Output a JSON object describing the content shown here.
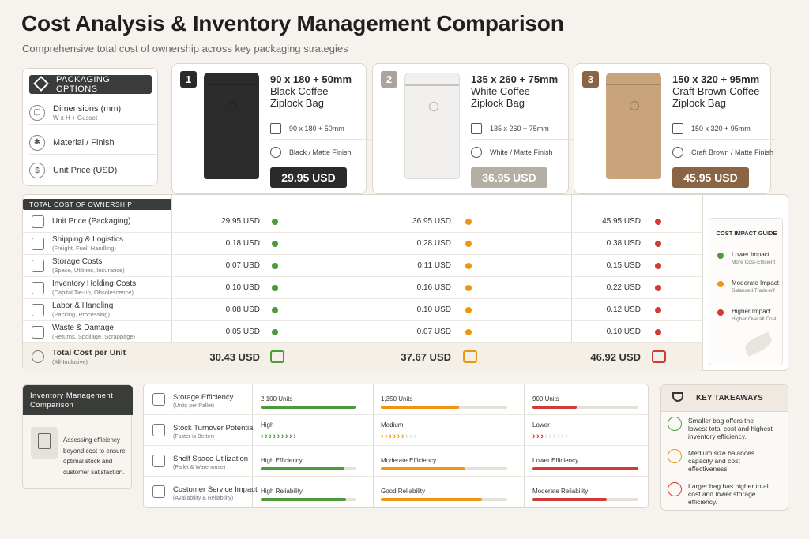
{
  "title": "Cost Analysis & Inventory Management Comparison",
  "subtitle": "Comprehensive total cost of ownership across key packaging strategies",
  "options": {
    "header": "PACKAGING OPTIONS",
    "rows": [
      {
        "label": "Dimensions (mm)",
        "sub": "W x H + Gusset",
        "icon": "box-icon"
      },
      {
        "label": "Material / Finish",
        "sub": "",
        "icon": "snowflake-icon"
      },
      {
        "label": "Unit Price (USD)",
        "sub": "",
        "icon": "dollar-icon"
      }
    ]
  },
  "products": [
    {
      "num": "1",
      "title": "90 x 180 + 50mm",
      "name1": "Black Coffee",
      "name2": "Ziplock Bag",
      "dims": "90 x 180 + 50mm",
      "finish": "Black / Matte Finish",
      "price": "29.95 USD",
      "color": "#2a2a2a",
      "bag": "#2c2c2c",
      "numColor": "#2a2a2a"
    },
    {
      "num": "2",
      "title": "135 x 260 + 75mm",
      "name1": "White Coffee",
      "name2": "Ziplock Bag",
      "dims": "135 x 260 + 75mm",
      "finish": "White / Matte Finish",
      "price": "36.95 USD",
      "color": "#b5aea3",
      "bag": "#f1f0ee",
      "numColor": "#a9a49c"
    },
    {
      "num": "3",
      "title": "150 x 320 + 95mm",
      "name1": "Craft Brown Coffee",
      "name2": "Ziplock Bag",
      "dims": "150 x 320 + 95mm",
      "finish": "Craft Brown / Matte Finish",
      "price": "45.95 USD",
      "color": "#8b6443",
      "bag": "#c9a47a",
      "numColor": "#8b6443"
    }
  ],
  "tco": {
    "header": "TOTAL COST OF OWNERSHIP BREAKDOWN",
    "rows": [
      {
        "label": "Unit Price (Packaging)",
        "sub": "",
        "icon": "tag-icon",
        "v": [
          "29.95 USD",
          "36.95 USD",
          "45.95 USD"
        ]
      },
      {
        "label": "Shipping & Logistics",
        "sub": "(Freight, Fuel, Handling)",
        "icon": "truck-icon",
        "v": [
          "0.18 USD",
          "0.28 USD",
          "0.38 USD"
        ]
      },
      {
        "label": "Storage Costs",
        "sub": "(Space, Utilities, Insurance)",
        "icon": "warehouse-icon",
        "v": [
          "0.07 USD",
          "0.11 USD",
          "0.15 USD"
        ]
      },
      {
        "label": "Inventory Holding Costs",
        "sub": "(Capital Tie-up, Obsolescence)",
        "icon": "bar-chart-icon",
        "v": [
          "0.10 USD",
          "0.16 USD",
          "0.22 USD"
        ]
      },
      {
        "label": "Labor & Handling",
        "sub": "(Packing, Processing)",
        "icon": "person-icon",
        "v": [
          "0.08 USD",
          "0.10 USD",
          "0.12 USD"
        ]
      },
      {
        "label": "Waste & Damage",
        "sub": "(Returns, Spoilage, Scrappage)",
        "icon": "trash-icon",
        "v": [
          "0.05 USD",
          "0.07 USD",
          "0.10 USD"
        ]
      }
    ],
    "total": {
      "label": "Total Cost per Unit",
      "sub": "(All-Inclusive)",
      "v": [
        "30.43 USD",
        "37.67 USD",
        "46.92 USD"
      ]
    }
  },
  "guide": {
    "header": "COST IMPACT GUIDE",
    "items": [
      {
        "label": "Lower Impact",
        "sub": "More Cost-Efficient",
        "color": "#4d9a3b"
      },
      {
        "label": "Moderate Impact",
        "sub": "Balanced Trade-off",
        "color": "#f0950f"
      },
      {
        "label": "Higher Impact",
        "sub": "Higher Overall Cost",
        "color": "#d23a35"
      }
    ]
  },
  "inventory": {
    "header1": "Inventory Management",
    "header2": "Comparison",
    "desc": [
      "Assessing efficiency",
      "beyond cost to ensure",
      "optimal stock and",
      "customer satisfaction."
    ],
    "rows": [
      {
        "label": "Storage Efficiency",
        "sub": "(Units per Pallet)",
        "v": [
          "2,100 Units",
          "1,350 Units",
          "900 Units"
        ],
        "fill": [
          1.0,
          0.62,
          0.42
        ]
      },
      {
        "label": "Stock Turnover Potential",
        "sub": "(Faster is Better)",
        "v": [
          "High",
          "Medium",
          "Lower"
        ],
        "chev": [
          "> > > > > > > > >",
          "> > > > > > > > >",
          "> > > > > > > > >"
        ],
        "fill": [
          1.0,
          0.66,
          0.33
        ]
      },
      {
        "label": "Shelf Space Utilization",
        "sub": "(Pallet & Warehouse)",
        "v": [
          "High Efficiency",
          "Moderate Efficiency",
          "Lower Efficiency"
        ],
        "fill": [
          0.88,
          0.66,
          1.0
        ]
      },
      {
        "label": "Customer Service Impact",
        "sub": "(Availability & Reliability)",
        "v": [
          "High Reliability",
          "Good Reliability",
          "Moderate Reliability"
        ],
        "fill": [
          0.9,
          0.8,
          0.7
        ]
      }
    ]
  },
  "takeaways": {
    "header": "KEY TAKEAWAYS",
    "items": [
      {
        "lines": [
          "Smaller bag offers the",
          "lowest total cost and highest",
          "inventory efficiency."
        ],
        "color": "#4d9a3b"
      },
      {
        "lines": [
          "Medium size balances",
          "capacity and cost",
          "effectiveness."
        ],
        "color": "#f0950f"
      },
      {
        "lines": [
          "Larger bag has higher total",
          "cost and lower storage",
          "efficiency."
        ],
        "color": "#d23a35"
      }
    ]
  }
}
